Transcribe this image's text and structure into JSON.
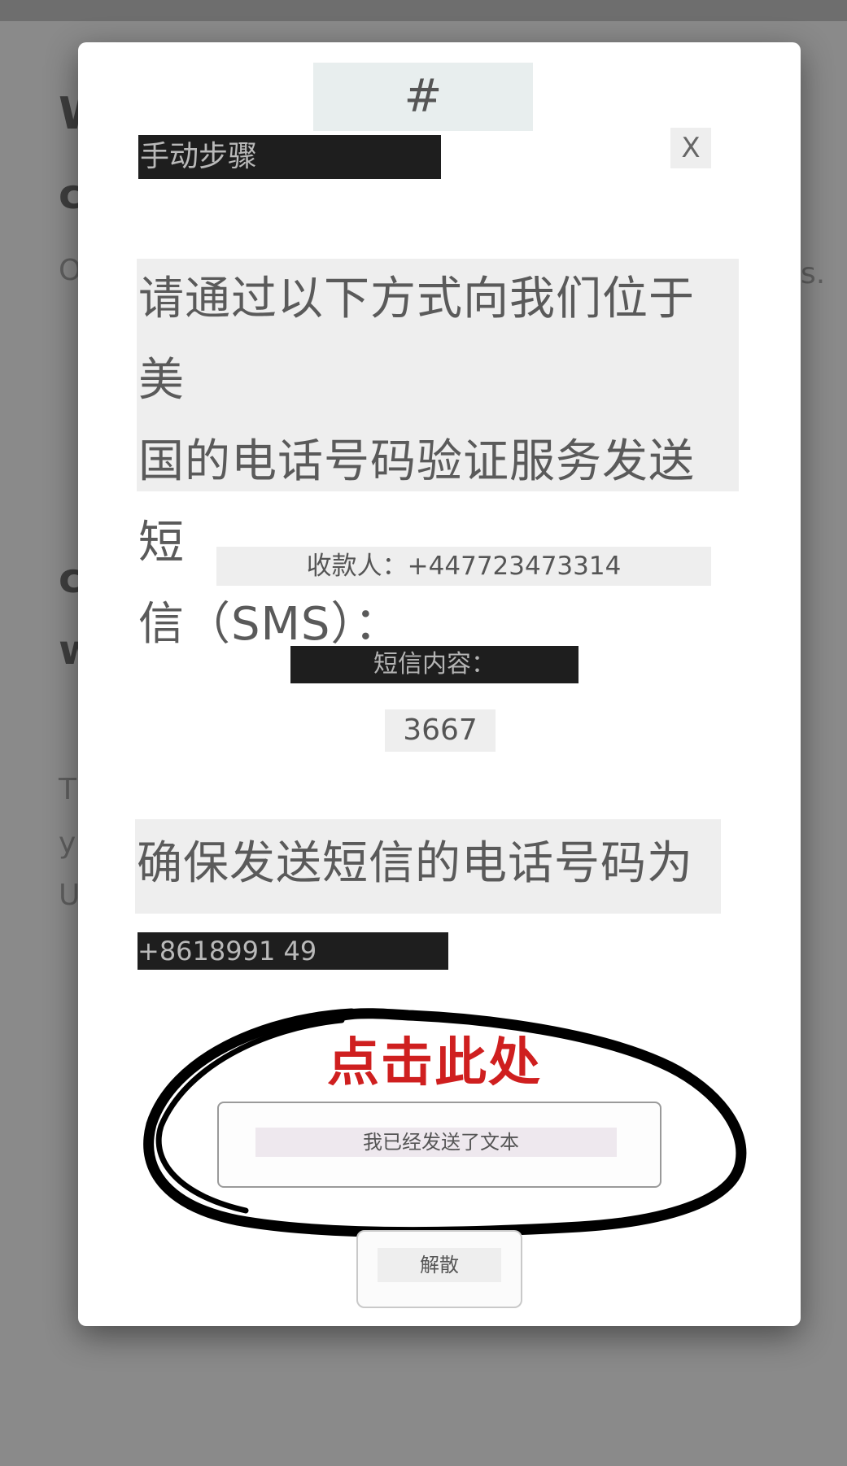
{
  "background": {
    "fragments": [
      "W",
      "c",
      "O",
      "s.",
      "c",
      "w",
      "T",
      "y",
      "U"
    ]
  },
  "modal": {
    "header_symbol": "#",
    "title": "手动步骤",
    "close_label": "X",
    "instruction_lines": [
      "请通过以下方式向我们位于美",
      "国的电话号码验证服务发送短",
      "信（SMS）："
    ],
    "recipient": "收款人：+447723473314",
    "sms_content_label": "短信内容：",
    "sms_code": "3667",
    "ensure_text": "确保发送短信的电话号码为",
    "sender_phone": "+8618991 49",
    "annotation": "点击此处",
    "sent_button_label": "我已经发送了文本",
    "dismiss_button_label": "解散"
  },
  "colors": {
    "annotation_red": "#cf1f1f",
    "redaction_black": "#1e1e1e",
    "overlay_gray": "#8a8a8a"
  }
}
